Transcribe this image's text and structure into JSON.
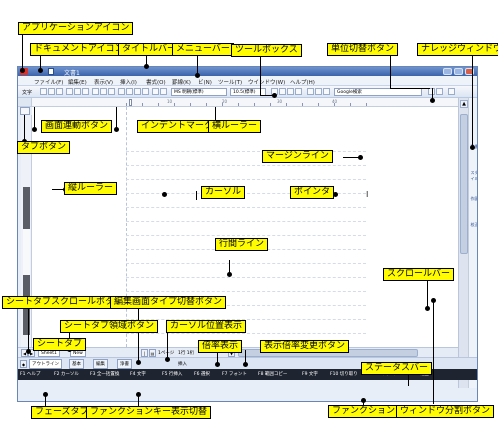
{
  "window": {
    "title": "文書1",
    "menu": [
      "ファイル(F)",
      "編集(E)",
      "表示(V)",
      "挿入(I)",
      "書式(O)",
      "罫線(K)",
      "ビ(N)",
      "ツール(T)",
      "ウインドウ(W)",
      "ヘルプ(H)"
    ],
    "toolbar": {
      "mode_label": "文字",
      "font": "MS 明朝(標準)",
      "size": "10.5(標準)",
      "search_placeholder": "Google検索"
    },
    "ruler_numbers": [
      "10",
      "20",
      "30",
      "40"
    ],
    "sheet_tab": "Sheet1",
    "new_tab": "New",
    "page_indicator": "1ページ",
    "cursor_position": "1行  1桁",
    "zoom": "100%",
    "insert_mode": "挿入",
    "phase_tabs": [
      "アウトライン",
      "基本",
      "編集",
      "浄書"
    ],
    "side_tools": [
      "辞書",
      "スタイル",
      "作図",
      "校正"
    ],
    "fkeys": [
      "F1 ヘルプ",
      "F2 カーソル",
      "F3 全一括置換",
      "F4 文字",
      "F5 行挿入",
      "F6 選択",
      "F7 フォント",
      "F8 範囲コピー",
      "F9 文字",
      "F10 切り取り",
      "F11 コマンド",
      "F12 範囲"
    ]
  },
  "labels": {
    "app_icon": "アプリケーションアイコン",
    "doc_icon": "ドキュメントアイコン",
    "titlebar": "タイトルバー",
    "menubar": "メニューバー",
    "toolbox": "ツールボックス",
    "unit_toggle": "単位切替ボタン",
    "palette_window": "ナレッジウィンドウ",
    "screen_link": "画面連動ボタン",
    "indent_marker": "インデントマーク",
    "h_ruler": "横ルーラー",
    "tab_button": "タブボタン",
    "margin_line": "マージンライン",
    "v_ruler": "縦ルーラー",
    "cursor": "カーソル",
    "pointer": "ポインタ",
    "line_spacing": "行間ライン",
    "scrollbar": "スクロールバー",
    "sheet_scroll": "シートタブスクロールボタン",
    "edit_type": "編集画面タイプ切替ボタン",
    "sheet_area": "シートタブ領域ボタン",
    "cursor_pos": "カーソル位置表示",
    "sheet_tab": "シートタブ",
    "zoom_display": "倍率表示",
    "zoom_change": "表示倍率変更ボタン",
    "status_bar": "ステータスバー",
    "phase_tab": "フェーズタブ",
    "fkey_toggle": "ファンクションキー表示切替",
    "function_key": "ファンクションキー",
    "window_split": "ウィンドウ分割ボタン"
  }
}
